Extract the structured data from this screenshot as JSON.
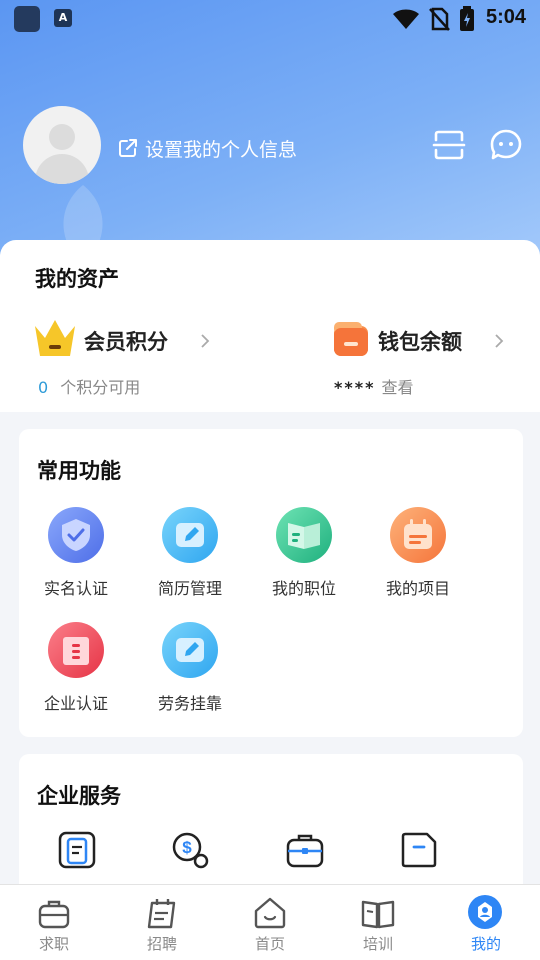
{
  "status_bar": {
    "time": "5:04",
    "app_icon_letter": "A"
  },
  "profile": {
    "edit_label": "设置我的个人信息"
  },
  "assets": {
    "title": "我的资产",
    "points": {
      "label": "会员积分",
      "value": "0",
      "caption": "个积分可用"
    },
    "wallet": {
      "label": "钱包余额",
      "masked": "****",
      "caption": "查看"
    }
  },
  "common_functions": {
    "title": "常用功能",
    "items": [
      {
        "label": "实名认证",
        "icon": "verified-shield-icon",
        "color": "#5b7cf0"
      },
      {
        "label": "简历管理",
        "icon": "resume-edit-icon",
        "color": "#3fb4f2"
      },
      {
        "label": "我的职位",
        "icon": "position-book-icon",
        "color": "#2fc28e"
      },
      {
        "label": "我的项目",
        "icon": "project-calendar-icon",
        "color": "#f98f4c"
      },
      {
        "label": "企业认证",
        "icon": "company-building-icon",
        "color": "#ef5260"
      },
      {
        "label": "劳务挂靠",
        "icon": "labor-edit-icon",
        "color": "#3fb4f2"
      }
    ]
  },
  "enterprise_services": {
    "title": "企业服务",
    "items": [
      {
        "icon": "document-icon"
      },
      {
        "icon": "money-icon"
      },
      {
        "icon": "briefcase-icon"
      },
      {
        "icon": "folder-icon"
      }
    ]
  },
  "tabbar": {
    "items": [
      {
        "label": "求职",
        "icon": "job-bag-icon"
      },
      {
        "label": "招聘",
        "icon": "recruit-calendar-icon"
      },
      {
        "label": "首页",
        "icon": "home-icon"
      },
      {
        "label": "培训",
        "icon": "training-book-icon"
      },
      {
        "label": "我的",
        "icon": "me-icon",
        "active": true
      }
    ],
    "active_color": "#2e86f5"
  }
}
